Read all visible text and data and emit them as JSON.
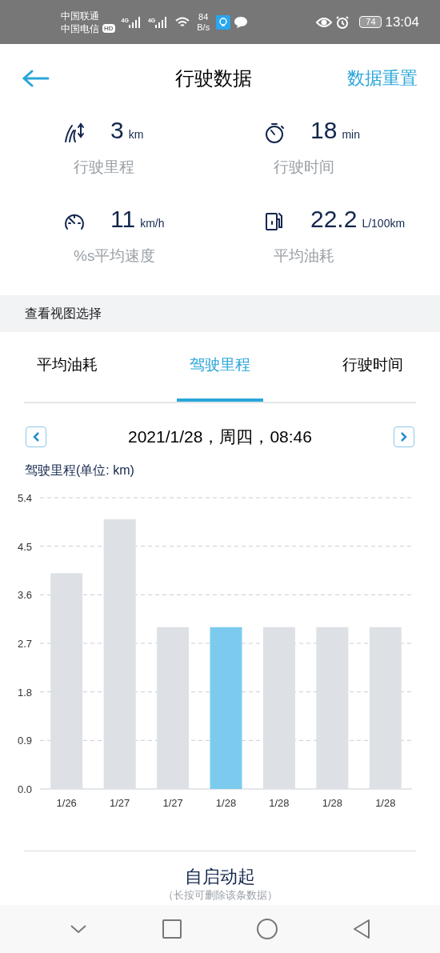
{
  "status_bar": {
    "carriers": [
      "中国联通",
      "中国电信"
    ],
    "hd": "HD",
    "networks": [
      "4G",
      "4G"
    ],
    "speed": "84",
    "speed_unit": "B/s",
    "battery": "74",
    "time": "13:04"
  },
  "header": {
    "title": "行驶数据",
    "action": "数据重置"
  },
  "stats": [
    {
      "kind": "distance",
      "value": "3",
      "unit": "km",
      "label": "行驶里程"
    },
    {
      "kind": "time",
      "value": "18",
      "unit": "min",
      "label": "行驶时间"
    },
    {
      "kind": "speed",
      "value": "11",
      "unit": "km/h",
      "label": "%s平均速度"
    },
    {
      "kind": "fuel",
      "value": "22.2",
      "unit": "L/100km",
      "label": "平均油耗"
    }
  ],
  "section_title": "查看视图选择",
  "tabs": [
    {
      "label": "平均油耗",
      "selected": false
    },
    {
      "label": "驾驶里程",
      "selected": true
    },
    {
      "label": "行驶时间",
      "selected": false
    }
  ],
  "date": "2021/1/28，周四，08:46",
  "chart": {
    "label": "驾驶里程(单位: km)",
    "bar_states": [
      {
        "color": "#dde1e5"
      },
      {
        "color": "#dde1e5"
      },
      {
        "color": "#dde1e5"
      },
      {
        "color": "#7ccbee"
      },
      {
        "color": "#dde1e5"
      },
      {
        "color": "#dde1e5"
      },
      {
        "color": "#dde1e5"
      }
    ],
    "chart_data": {
      "type": "bar",
      "categories": [
        "1/26",
        "1/27",
        "1/27",
        "1/28",
        "1/28",
        "1/28",
        "1/28"
      ],
      "series": [
        {
          "values": [
            4,
            5,
            3,
            3,
            3,
            3,
            3
          ]
        }
      ],
      "grid": true,
      "ylim": [
        0,
        5.4
      ],
      "yticks": [
        {
          "value": 0,
          "label": "0.0"
        },
        {
          "value": 0.9,
          "label": "0.9"
        },
        {
          "value": 1.8,
          "label": "1.8"
        },
        {
          "value": 2.7,
          "label": "2.7"
        },
        {
          "value": 3.6,
          "label": "3.6"
        },
        {
          "value": 4.5,
          "label": "4.5"
        },
        {
          "value": 5.4,
          "label": "5.4"
        }
      ]
    }
  },
  "trip": {
    "title": "自启动起",
    "hint": "（长按可删除该条数据）"
  }
}
